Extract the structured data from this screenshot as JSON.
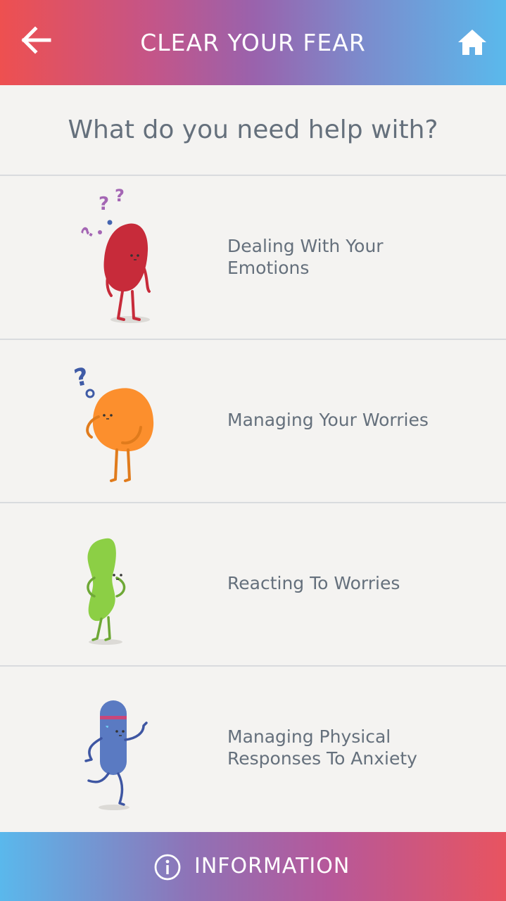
{
  "header": {
    "title": "CLEAR YOUR FEAR",
    "back_icon": "back-arrow-icon",
    "home_icon": "home-icon"
  },
  "prompt": "What do you need help with?",
  "topics": [
    {
      "label": "Dealing With Your Emotions",
      "character": "red-confused-character",
      "color": "#c72b3a"
    },
    {
      "label": "Managing Your Worries",
      "character": "orange-thinking-character",
      "color": "#fc8f2d"
    },
    {
      "label": "Reacting To Worries",
      "character": "green-bean-character",
      "color": "#8ccf45"
    },
    {
      "label": "Managing Physical Responses To Anxiety",
      "character": "blue-running-character",
      "color": "#5a7ac2"
    }
  ],
  "footer": {
    "label": "INFORMATION",
    "icon": "info-icon"
  },
  "colors": {
    "background": "#f4f3f1",
    "text": "#65707c",
    "divider": "#d9dbde"
  }
}
